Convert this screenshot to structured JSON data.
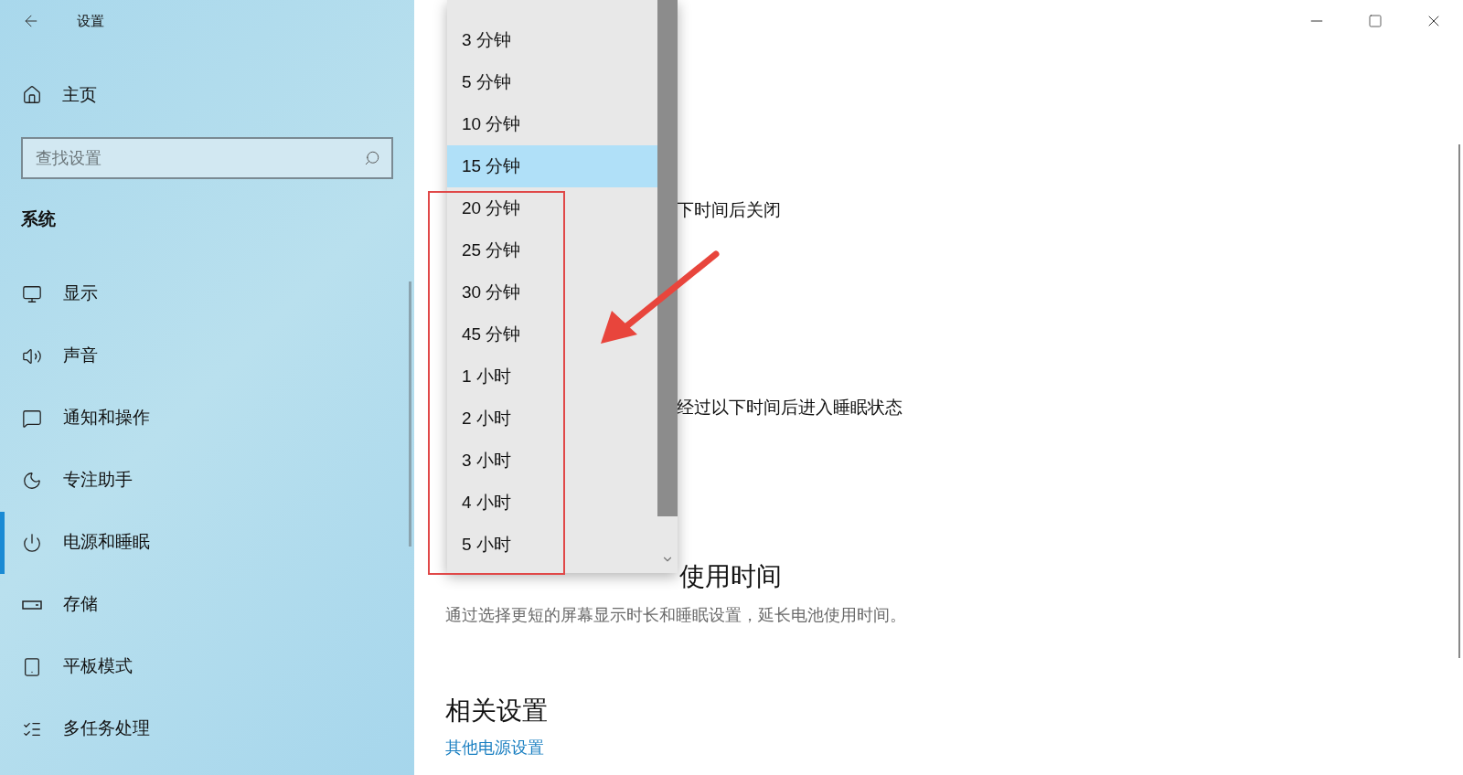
{
  "window": {
    "title": "设置"
  },
  "sidebar": {
    "home": "主页",
    "search": {
      "placeholder": "查找设置"
    },
    "section": "系统",
    "items": [
      {
        "kind": "display",
        "label": "显示",
        "selected": false
      },
      {
        "kind": "sound",
        "label": "声音",
        "selected": false
      },
      {
        "kind": "notify",
        "label": "通知和操作",
        "selected": false
      },
      {
        "kind": "focus",
        "label": "专注助手",
        "selected": false
      },
      {
        "kind": "power",
        "label": "电源和睡眠",
        "selected": true
      },
      {
        "kind": "storage",
        "label": "存储",
        "selected": false
      },
      {
        "kind": "tablet",
        "label": "平板模式",
        "selected": false
      },
      {
        "kind": "multitask",
        "label": "多任务处理",
        "selected": false
      }
    ]
  },
  "dropdown": {
    "options": [
      {
        "label": "3 分钟",
        "selected": false
      },
      {
        "label": "5 分钟",
        "selected": false
      },
      {
        "label": "10 分钟",
        "selected": false
      },
      {
        "label": "15 分钟",
        "selected": true
      },
      {
        "label": "20 分钟",
        "selected": false
      },
      {
        "label": "25 分钟",
        "selected": false
      },
      {
        "label": "30 分钟",
        "selected": false
      },
      {
        "label": "45 分钟",
        "selected": false
      },
      {
        "label": "1 小时",
        "selected": false
      },
      {
        "label": "2 小时",
        "selected": false
      },
      {
        "label": "3 小时",
        "selected": false
      },
      {
        "label": "4 小时",
        "selected": false
      },
      {
        "label": "5 小时",
        "selected": false
      }
    ]
  },
  "content": {
    "screen_label": "下时间后关闭",
    "sleep_label": "经过以下时间后进入睡眠状态",
    "battery_heading": "使用时间",
    "battery_description": "通过选择更短的屏幕显示时长和睡眠设置，延长电池使用时间。",
    "related_heading": "相关设置",
    "related_link": "其他电源设置"
  }
}
